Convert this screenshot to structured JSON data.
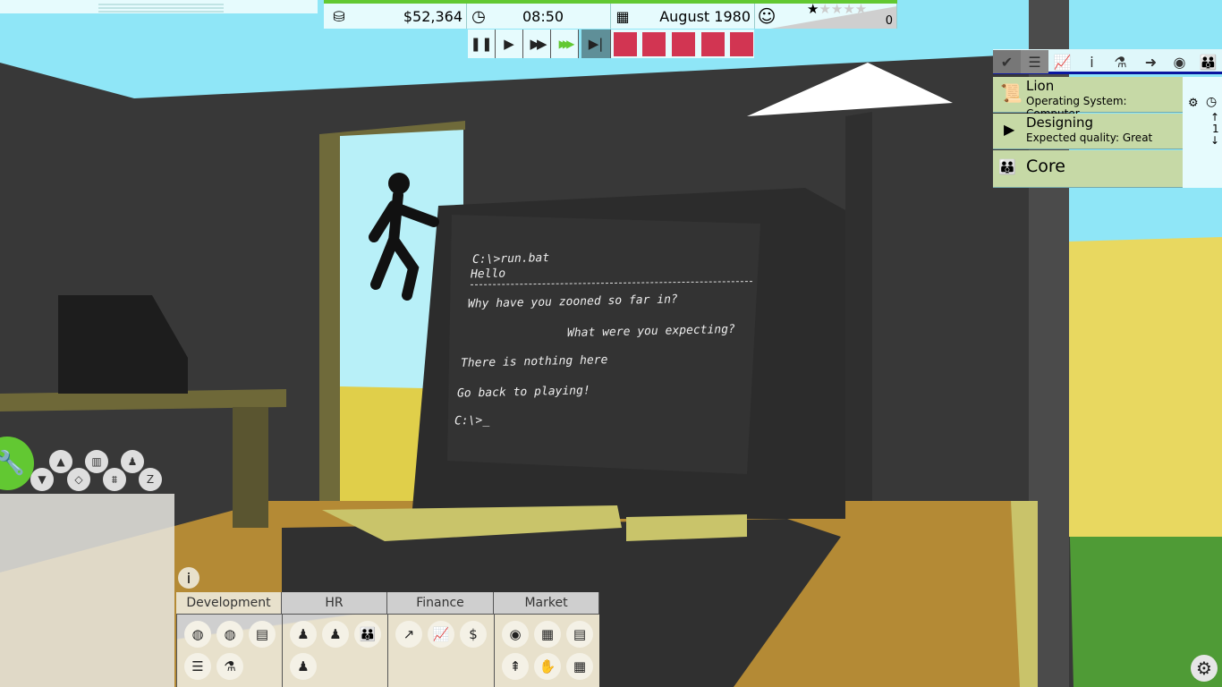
{
  "hud": {
    "money": "$52,364",
    "time": "08:50",
    "date": "August 1980",
    "rating_stars": 1,
    "rating_max": 5,
    "rating_count": "0",
    "money_icon": "coins-icon",
    "time_icon": "clock-icon",
    "date_icon": "calendar-icon",
    "mood_icon": "smiley-icon"
  },
  "speed_controls": [
    {
      "name": "pause",
      "glyph": "❚❚"
    },
    {
      "name": "play",
      "glyph": "▶"
    },
    {
      "name": "fast-forward",
      "glyph": "▶▶"
    },
    {
      "name": "fastest",
      "glyph": "▶▶▶"
    },
    {
      "name": "skip",
      "glyph": "▶|"
    }
  ],
  "speed_active": "fastest",
  "terminal": {
    "lines": [
      "C:\\>run.bat",
      "Hello",
      "Why have you zooned so far in?",
      "What were you expecting?",
      "There is nothing here",
      "Go back to playing!",
      "C:\\>_"
    ]
  },
  "right_panel": {
    "tabs": [
      "✔",
      "☰",
      "📈",
      "i",
      "⚗",
      "➜",
      "◉",
      "👪"
    ],
    "project": {
      "name": "Lion",
      "subtitle": "Operating System: Computer"
    },
    "status": {
      "name": "Designing",
      "subtitle": "Expected quality: Great"
    },
    "team": {
      "name": "Core"
    },
    "priority": "1"
  },
  "build_tools": [
    "wrench-icon",
    "floor-down-icon",
    "floor-up-icon",
    "floor-plan-icon",
    "stats-icon",
    "furniture-icon",
    "team-icon",
    "path-icon"
  ],
  "bottom_menu": {
    "info": "i",
    "tabs": [
      {
        "label": "Development",
        "icons": [
          "◍",
          "◍",
          "▤",
          "☰",
          "⚗"
        ]
      },
      {
        "label": "HR",
        "icons": [
          "♟",
          "♟",
          "👪",
          "♟"
        ]
      },
      {
        "label": "Finance",
        "icons": [
          "↗",
          "📈",
          "$"
        ]
      },
      {
        "label": "Market",
        "icons": [
          "◉",
          "▦",
          "▤",
          "⇞",
          "✋",
          "▦"
        ]
      }
    ]
  },
  "colors": {
    "accent_green": "#62c832",
    "panel_green": "#c6d9a6",
    "alert_red": "#d23552",
    "menu_beige": "#e8e1cc"
  }
}
